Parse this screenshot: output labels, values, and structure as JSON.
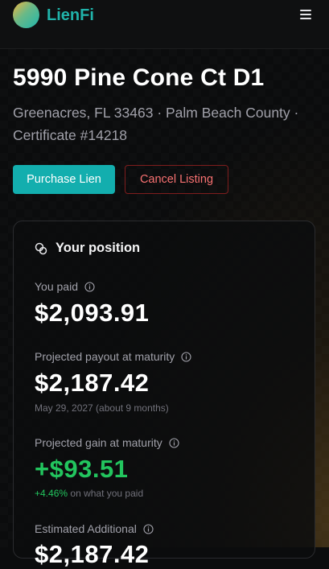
{
  "app": {
    "name": "LienFi"
  },
  "property": {
    "address": "5990 Pine Cone Ct D1",
    "location": "Greenacres, FL 33463 · Palm Beach County · Certificate #14218"
  },
  "actions": {
    "purchase_label": "Purchase Lien",
    "cancel_label": "Cancel Listing"
  },
  "position": {
    "title": "Your position",
    "paid_label": "You paid",
    "paid_value": "$2,093.91",
    "payout_label": "Projected payout at maturity",
    "payout_value": "$2,187.42",
    "payout_note": "May 29, 2027 (about 9 months)",
    "gain_label": "Projected gain at maturity",
    "gain_value": "+$93.51",
    "gain_pct": "+4.46%",
    "gain_note": "on what you paid",
    "additional_label": "Estimated Additional",
    "additional_value": "$2,187.42"
  },
  "colors": {
    "accent": "#13aeae",
    "danger": "#f87171",
    "gain": "#22c55e"
  },
  "icons": [
    "menu-icon",
    "coins-icon",
    "info-icon"
  ]
}
